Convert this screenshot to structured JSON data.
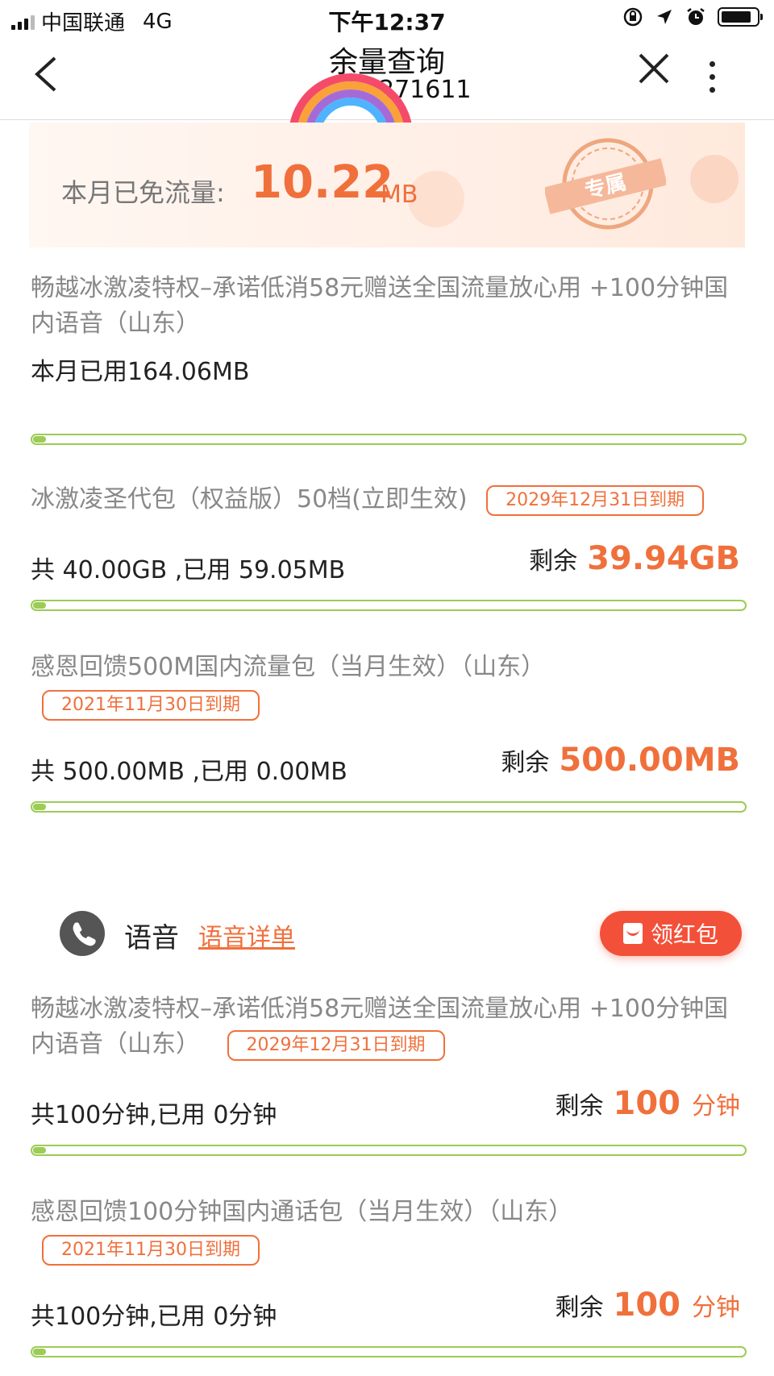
{
  "status_bar": {
    "carrier": "中国联通",
    "network": "4G",
    "time": "下午12:37"
  },
  "nav": {
    "title": "余量查询",
    "subtitle": "271611"
  },
  "banner": {
    "label": "本月已免流量:",
    "value": "10.22",
    "unit": "MB",
    "stamp_text": "专属"
  },
  "data_packages": [
    {
      "name": "畅越冰激凌特权–承诺低消58元赠送全国流量放心用 +100分钟国内语音（山东）",
      "usage": "本月已用164.06MB",
      "progress": 0.01
    },
    {
      "name": "冰激凌圣代包（权益版）50档(立即生效)",
      "expiry": "2029年12月31日到期",
      "usage": "共 40.00GB ,已用 59.05MB",
      "remain_label": "剩余",
      "remain_value": "39.94GB",
      "progress": 0.01
    },
    {
      "name": "感恩回馈500M国内流量包（当月生效）（山东）",
      "expiry": "2021年11月30日到期",
      "usage": "共 500.00MB ,已用 0.00MB",
      "remain_label": "剩余",
      "remain_value": "500.00MB",
      "progress": 0.0
    }
  ],
  "voice": {
    "title": "语音",
    "detail_link": "语音详单",
    "red_packet": "领红包",
    "packages": [
      {
        "name": "畅越冰激凌特权–承诺低消58元赠送全国流量放心用 +100分钟国内语音（山东）",
        "expiry": "2029年12月31日到期",
        "usage": "共100分钟,已用 0分钟",
        "remain_label": "剩余",
        "remain_value": "100",
        "remain_unit": "分钟",
        "progress": 0.0
      },
      {
        "name": "感恩回馈100分钟国内通话包（当月生效）（山东）",
        "expiry": "2021年11月30日到期",
        "usage": "共100分钟,已用 0分钟",
        "remain_label": "剩余",
        "remain_value": "100",
        "remain_unit": "分钟",
        "progress": 0.0
      }
    ]
  },
  "colors": {
    "accent": "#f0703c",
    "progress": "#9ccc55",
    "red_packet": "#f3503a"
  }
}
